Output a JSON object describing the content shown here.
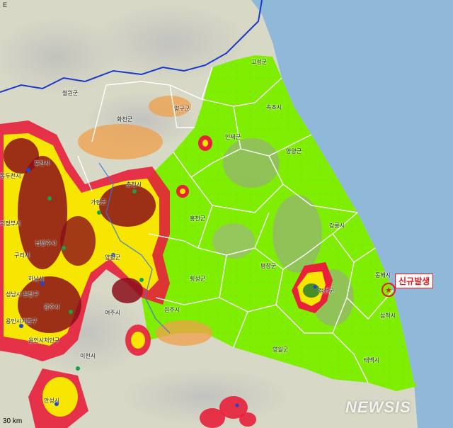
{
  "map": {
    "labels": {
      "goseong": "고성군",
      "sokcho": "속초시",
      "cheorwon": "철원군",
      "hwacheon": "화천군",
      "yanggu": "양구군",
      "inje": "인제군",
      "yangyang": "양양군",
      "chuncheon": "춘천시",
      "gapyeong": "가평군",
      "hongcheon": "홍천군",
      "gangneung": "강릉시",
      "pyeongchang": "평창군",
      "hoengseong": "횡성군",
      "yangpyeong": "양평군",
      "jeongseon": "정선군",
      "donghae": "동해시",
      "wonju": "원주시",
      "yeoju": "여주시",
      "samcheok": "삼척시",
      "yeongwol": "영월군",
      "taebaek": "태백시",
      "icheon": "이천시",
      "anseong": "안성시",
      "namyangju": "남양주시",
      "guri": "구리시",
      "hanam": "하남시",
      "gwangju": "광주시",
      "seongnam_bundang": "성남시 분당구",
      "yongin_giheung": "용인시기흥구",
      "yongin_cheoin": "용인시처인구",
      "gapyeong_pocheon": "포천시",
      "dongducheon": "동두천시",
      "uijeongbu": "의정부시"
    },
    "callout": "신규발생",
    "scale": "30 km",
    "compass": "E",
    "watermark": "NEWSIS"
  },
  "colors": {
    "sea": "#8fb8d9",
    "basemap": "#d9d9c8",
    "forest_green": "#7cf000",
    "risk_red": "#e8203a",
    "outbreak_dark": "#8b0f1a",
    "buffer_yellow": "#f7e600",
    "boundary": "#ffffff",
    "national_boundary": "#1a39c8",
    "callout_red": "#e41a1c"
  }
}
